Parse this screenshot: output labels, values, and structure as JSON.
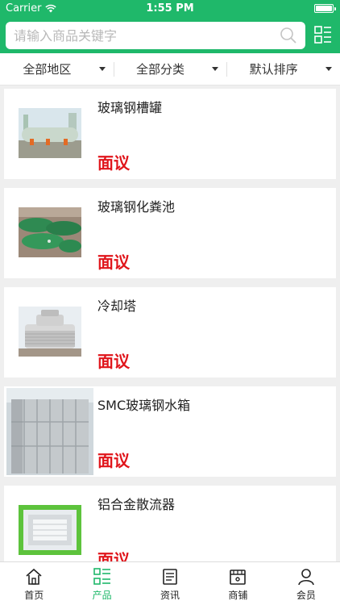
{
  "status_bar": {
    "carrier": "Carrier",
    "time": "1:55 PM"
  },
  "search": {
    "placeholder": "请输入商品关键字"
  },
  "filters": [
    {
      "label": "全部地区"
    },
    {
      "label": "全部分类"
    },
    {
      "label": "默认排序"
    }
  ],
  "products": [
    {
      "name": "玻璃钢槽罐",
      "price": "面议"
    },
    {
      "name": "玻璃钢化粪池",
      "price": "面议"
    },
    {
      "name": "冷却塔",
      "price": "面议"
    },
    {
      "name": "SMC玻璃钢水箱",
      "price": "面议"
    },
    {
      "name": "铝合金散流器",
      "price": "面议"
    }
  ],
  "tabs": [
    {
      "label": "首页",
      "icon": "home-icon"
    },
    {
      "label": "产品",
      "icon": "products-icon"
    },
    {
      "label": "资讯",
      "icon": "news-icon"
    },
    {
      "label": "商铺",
      "icon": "shop-icon"
    },
    {
      "label": "会员",
      "icon": "member-icon"
    }
  ],
  "colors": {
    "brand": "#1fb86a",
    "price": "#e0151b",
    "active_tab": "#1fb86a"
  }
}
